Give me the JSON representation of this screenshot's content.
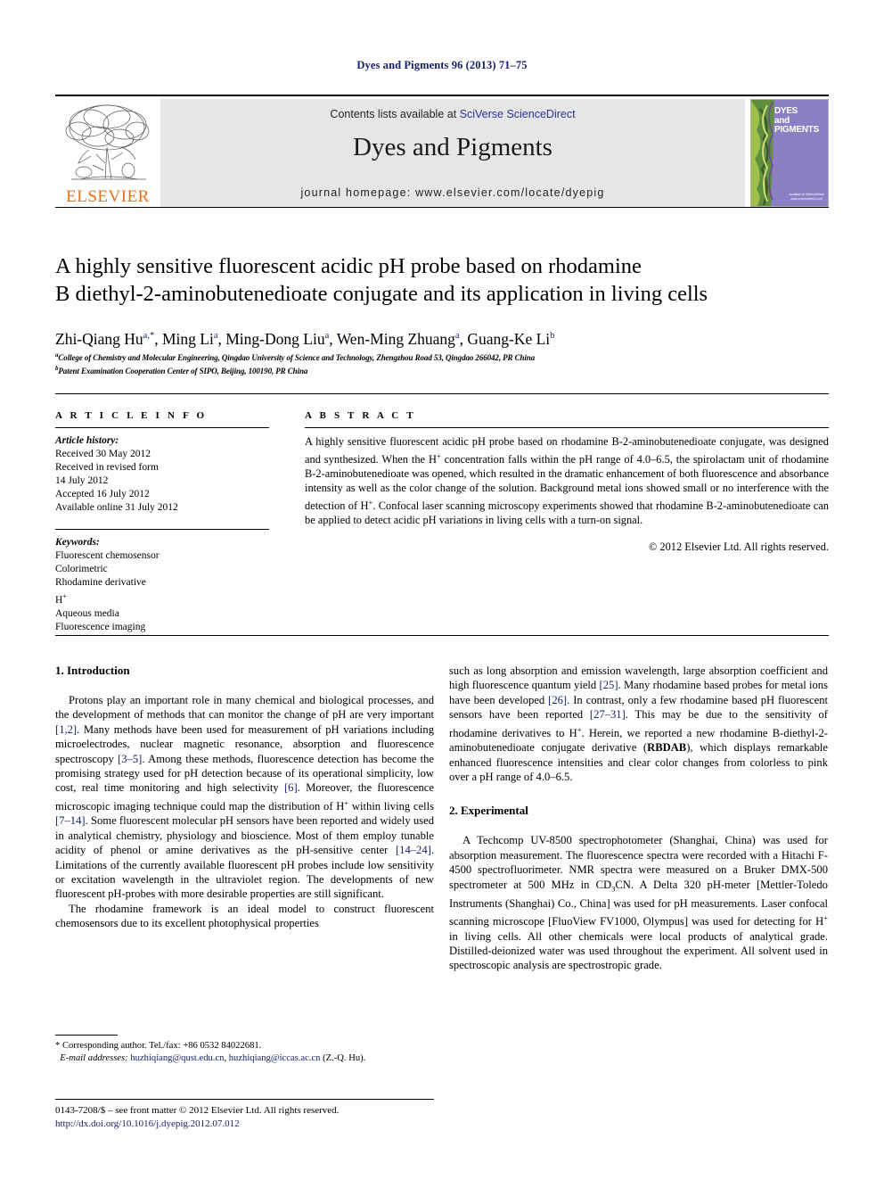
{
  "running_head": "Dyes and Pigments 96 (2013) 71–75",
  "masthead": {
    "elsevier_wordmark": "ELSEVIER",
    "contents_prefix": "Contents lists available at ",
    "sciencedirect_link": "SciVerse ScienceDirect",
    "journal_title": "Dyes and Pigments",
    "journal_homepage": "journal homepage: www.elsevier.com/locate/dyepig",
    "cover": {
      "line1": "DYES",
      "line2": "and",
      "line3": "PIGMENTS",
      "footer": "available at\nScienceDirect\nwww.sciencedirect.com"
    },
    "colors": {
      "banner_bg": "#e6e6e6",
      "link_blue": "#2b2f9e",
      "elsevier_orange": "#e8701a",
      "cover_purple": "#8d7fc4"
    }
  },
  "article": {
    "title_line1": "A highly sensitive fluorescent acidic pH probe based on rhodamine",
    "title_line2": "B diethyl-2-aminobutenedioate conjugate and its application in living cells",
    "authors": [
      {
        "name": "Zhi-Qiang Hu",
        "marks": "a,*"
      },
      {
        "name": "Ming Li",
        "marks": "a"
      },
      {
        "name": "Ming-Dong Liu",
        "marks": "a"
      },
      {
        "name": "Wen-Ming Zhuang",
        "marks": "a"
      },
      {
        "name": "Guang-Ke Li",
        "marks": "b"
      }
    ],
    "affiliations": [
      {
        "mark": "a",
        "text": "College of Chemistry and Molecular Engineering, Qingdao University of Science and Technology, Zhengzhou Road 53, Qingdao 266042, PR China"
      },
      {
        "mark": "b",
        "text": "Patent Examination Cooperation Center of SIPO, Beijing, 100190, PR China"
      }
    ]
  },
  "article_info": {
    "heading": "A R T I C L E   I N F O",
    "history_label": "Article history:",
    "history": [
      "Received 30 May 2012",
      "Received in revised form",
      "14 July 2012",
      "Accepted 16 July 2012",
      "Available online 31 July 2012"
    ],
    "keywords_label": "Keywords:",
    "keywords": [
      "Fluorescent chemosensor",
      "Colorimetric",
      "Rhodamine derivative",
      "H+",
      "Aqueous media",
      "Fluorescence imaging"
    ]
  },
  "abstract": {
    "heading": "A B S T R A C T",
    "paragraphs": [
      "A highly sensitive fluorescent acidic pH probe based on rhodamine B-2-aminobutenedioate conjugate, was designed and synthesized. When the H+ concentration falls within the pH range of 4.0–6.5, the spirolactam unit of rhodamine B-2-aminobutenedioate was opened, which resulted in the dramatic enhancement of both fluorescence and absorbance intensity as well as the color change of the solution. Background metal ions showed small or no interference with the detection of H+. Confocal laser scanning microscopy experiments showed that rhodamine B-2-aminobutenedioate can be applied to detect acidic pH variations in living cells with a turn-on signal."
    ],
    "copyright": "© 2012 Elsevier Ltd. All rights reserved."
  },
  "sections": {
    "introduction_title": "1.  Introduction",
    "introduction_p1": "Protons play an important role in many chemical and biological processes, and the development of methods that can monitor the change of pH are very important [1,2]. Many methods have been used for measurement of pH variations including microelectrodes, nuclear magnetic resonance, absorption and fluorescence spectroscopy [3–5]. Among these methods, fluorescence detection has become the promising strategy used for pH detection because of its operational simplicity, low cost, real time monitoring and high selectivity [6]. Moreover, the fluorescence microscopic imaging technique could map the distribution of H+ within living cells [7–14]. Some fluorescent molecular pH sensors have been reported and widely used in analytical chemistry, physiology and bioscience. Most of them employ tunable acidity of phenol or amine derivatives as the pH-sensitive center [14–24]. Limitations of the currently available fluorescent pH probes include low sensitivity or excitation wavelength in the ultraviolet region. The developments of new fluorescent pH-probes with more desirable properties are still significant.",
    "introduction_p2": "The rhodamine framework is an ideal model to construct fluorescent chemosensors due to its excellent photophysical properties",
    "introduction_p3": "such as long absorption and emission wavelength, large absorption coefficient and high fluorescence quantum yield [25]. Many rhodamine based probes for metal ions have been developed [26]. In contrast, only a few rhodamine based pH fluorescent sensors have been reported [27–31]. This may be due to the sensitivity of rhodamine derivatives to H+. Herein, we reported a new rhodamine B-diethyl-2-aminobutenedioate conjugate derivative (RBDAB), which displays remarkable enhanced fluorescence intensities and clear color changes from colorless to pink over a pH range of 4.0–6.5.",
    "experimental_title": "2.  Experimental",
    "experimental_p1": "A Techcomp UV-8500 spectrophotometer (Shanghai, China) was used for absorption measurement. The fluorescence spectra were recorded with a Hitachi F-4500 spectrofluorimeter. NMR spectra were measured on a Bruker DMX-500 spectrometer at 500 MHz in CD3CN. A Delta 320 pH-meter [Mettler-Toledo Instruments (Shanghai) Co., China] was used for pH measurements. Laser confocal scanning microscope [FluoView FV1000, Olympus] was used for detecting for H+ in living cells. All other chemicals were local products of analytical grade. Distilled-deionized water was used throughout the experiment. All solvent used in spectroscopic analysis are spectrostropic grade."
  },
  "footnotes": {
    "corresponding": "* Corresponding author. Tel./fax: +86 0532 84022681.",
    "email_label": "E-mail addresses:",
    "email1": "huzhiqiang@qust.edu.cn",
    "email2": "huzhiqiang@iccas.ac.cn",
    "email_suffix": "(Z.-Q. Hu).",
    "issn_line": "0143-7208/$ – see front matter © 2012 Elsevier Ltd. All rights reserved.",
    "doi_line": "http://dx.doi.org/10.1016/j.dyepig.2012.07.012"
  }
}
